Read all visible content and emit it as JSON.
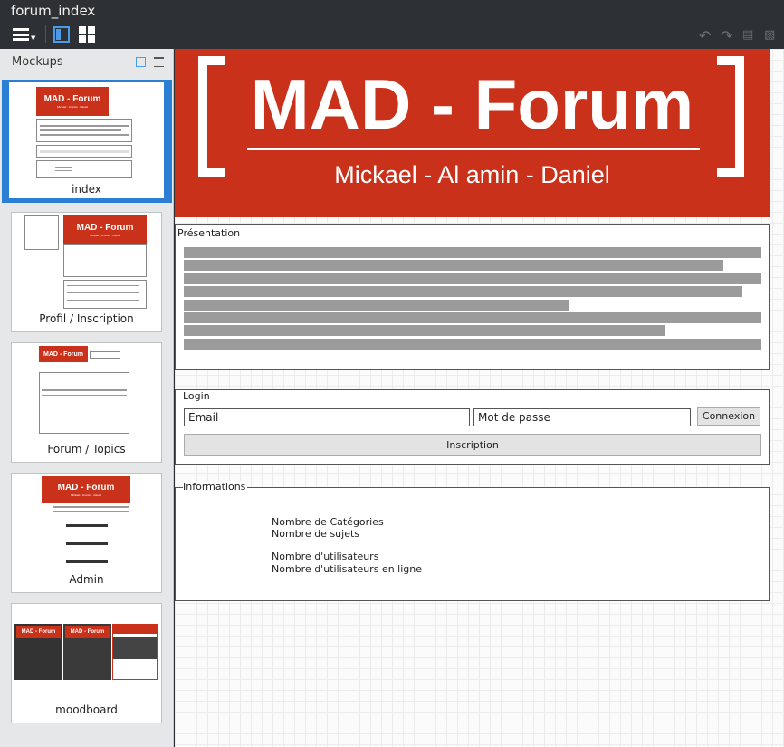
{
  "window": {
    "title": "forum_index"
  },
  "toolbar": {
    "icons": [
      "menu-icon",
      "panel-icon",
      "grid-icon",
      "undo-icon",
      "redo-icon",
      "copy-icon",
      "paste-icon"
    ]
  },
  "sidebar": {
    "title": "Mockups",
    "items": [
      {
        "label": "index",
        "active": true,
        "mini_logo": "MAD - Forum"
      },
      {
        "label": "Profil / Inscription",
        "active": false,
        "mini_logo": "MAD - Forum"
      },
      {
        "label": "Forum / Topics",
        "active": false,
        "mini_logo": "MAD - Forum"
      },
      {
        "label": "Admin",
        "active": false,
        "mini_logo": "MAD - Forum"
      },
      {
        "label": "moodboard",
        "active": false,
        "mini_logo": "MAD - Forum"
      }
    ]
  },
  "canvas": {
    "banner": {
      "title": "MAD - Forum",
      "subtitle": "Mickael - Al amin - Daniel",
      "color": "#c9311a"
    },
    "presentation": {
      "title": "Présentation"
    },
    "login": {
      "title": "Login",
      "email_value": "Email",
      "password_value": "Mot de passe",
      "connect_label": "Connexion",
      "register_label": "Inscription"
    },
    "informations": {
      "title": "Informations",
      "lines": [
        "Nombre de Catégories",
        "Nombre de sujets",
        "Nombre d'utilisateurs",
        "Nombre d'utilisateurs en ligne"
      ]
    }
  }
}
